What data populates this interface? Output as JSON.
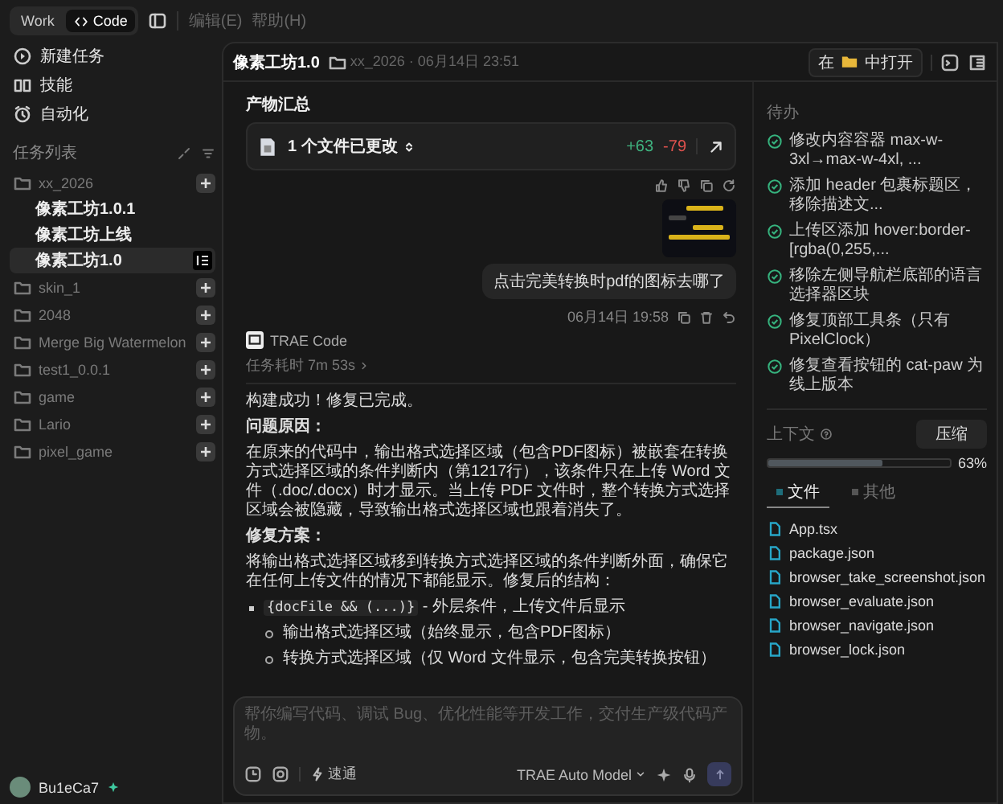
{
  "topbar": {
    "tabs": [
      {
        "label": "Work",
        "selected": false
      },
      {
        "label": "Code",
        "selected": true
      }
    ],
    "menu": [
      "编辑(E)",
      "帮助(H)"
    ]
  },
  "sidebar": {
    "actions": [
      "新建任务",
      "技能",
      "自动化"
    ],
    "task_list_title": "任务列表",
    "projects": [
      {
        "name": "xx_2026",
        "children": [
          {
            "name": "像素工坊1.0.1",
            "selected": false
          },
          {
            "name": "像素工坊上线",
            "selected": false
          },
          {
            "name": "像素工坊1.0",
            "selected": true
          }
        ]
      },
      {
        "name": "skin_1"
      },
      {
        "name": "2048"
      },
      {
        "name": "Merge Big Watermelon"
      },
      {
        "name": "test1_0.0.1"
      },
      {
        "name": "game"
      },
      {
        "name": "Lario"
      },
      {
        "name": "pixel_game"
      }
    ],
    "user": {
      "name": "Bu1eCa7"
    }
  },
  "header": {
    "title": "像素工坊1.0",
    "meta": "xx_2026 · 06月14日 23:51",
    "open_prefix": "在",
    "open_suffix": "中打开"
  },
  "chat": {
    "summary_title": "产物汇总",
    "changes": {
      "label": "1 个文件已更改",
      "added": "+63",
      "removed": "-79"
    },
    "user_message": {
      "text": "点击完美转换时pdf的图标去哪了",
      "time": "06月14日 19:58"
    },
    "assistant": {
      "name": "TRAE Code",
      "duration": "任务耗时 7m 53s",
      "blocks": [
        {
          "kind": "paragraph",
          "text": "构建成功！修复已完成。"
        },
        {
          "kind": "heading",
          "text": "问题原因："
        },
        {
          "kind": "paragraph",
          "text": "在原来的代码中，输出格式选择区域（包含PDF图标）被嵌套在转换方式选择区域的条件判断内（第1217行），该条件只在上传 Word 文件（.doc/.docx）时才显示。当上传 PDF 文件时，整个转换方式选择区域会被隐藏，导致输出格式选择区域也跟着消失了。"
        },
        {
          "kind": "heading",
          "text": "修复方案："
        },
        {
          "kind": "paragraph",
          "text": "将输出格式选择区域移到转换方式选择区域的条件判断外面，确保它在任何上传文件的情况下都能显示。修复后的结构："
        },
        {
          "kind": "bullet",
          "code": "{docFile && (...)}",
          "text": "- 外层条件，上传文件后显示",
          "children": [
            {
              "text": "输出格式选择区域（始终显示，包含PDF图标）"
            },
            {
              "text": "转换方式选择区域（仅 Word 文件显示，包含完美转换按钮）"
            }
          ]
        }
      ]
    },
    "composer": {
      "placeholder": "帮你编写代码、调试 Bug、优化性能等开发工作，交付生产级代码产物。",
      "mode": "速通",
      "model": "TRAE Auto Model"
    }
  },
  "panel": {
    "todo_title": "待办",
    "todos": [
      {
        "text": "修改内容容器 max-w-3xl→max-w-4xl, ...",
        "done": true
      },
      {
        "text": "添加 header 包裹标题区，移除描述文...",
        "done": true
      },
      {
        "text": "上传区添加 hover:border-[rgba(0,255,...",
        "done": true
      },
      {
        "text": "移除左侧导航栏底部的语言选择器区块",
        "done": true
      },
      {
        "text": "修复顶部工具条（只有 PixelClock）",
        "done": true
      },
      {
        "text": "修复查看按钮的 cat-paw 为线上版本",
        "done": true
      }
    ],
    "context": {
      "title": "上下文",
      "compress": "压缩",
      "level": 0.63,
      "reading": "63%"
    },
    "tabs": [
      {
        "label": "文件",
        "selected": true
      },
      {
        "label": "其他",
        "selected": false
      }
    ],
    "files": [
      "App.tsx",
      "package.json",
      "browser_take_screenshot.json",
      "browser_evaluate.json",
      "browser_navigate.json",
      "browser_lock.json"
    ]
  }
}
